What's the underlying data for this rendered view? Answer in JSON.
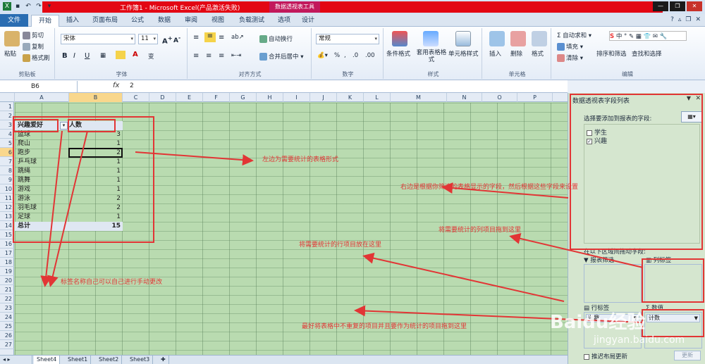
{
  "titlebar": {
    "title": "工作簿1 - Microsoft Excel(产品激活失败)",
    "context_tab": "数据透视表工具"
  },
  "tabs": [
    "文件",
    "开始",
    "插入",
    "页面布局",
    "公式",
    "数据",
    "审阅",
    "视图",
    "负载测试",
    "选项",
    "设计"
  ],
  "ribbon": {
    "clipboard": {
      "paste": "粘贴",
      "cut": "剪切",
      "copy": "复制",
      "format_painter": "格式刷",
      "label": "剪贴板"
    },
    "font": {
      "name": "宋体",
      "size": "11",
      "label": "字体"
    },
    "alignment": {
      "wrap": "自动换行",
      "merge": "合并后居中",
      "label": "对齐方式"
    },
    "number": {
      "format": "常规",
      "label": "数字"
    },
    "styles": {
      "conditional": "条件格式",
      "table": "套用表格格式",
      "cell": "单元格样式",
      "label": "样式"
    },
    "cells": {
      "insert": "插入",
      "delete": "删除",
      "format": "格式",
      "label": "单元格"
    },
    "editing": {
      "autosum": "自动求和",
      "fill": "填充",
      "clear": "清除",
      "sort": "排序和筛选",
      "find": "查找和选择",
      "label": "编辑"
    }
  },
  "formula_bar": {
    "name_box": "B6",
    "fx": "fx",
    "value": "2"
  },
  "columns": [
    "A",
    "B",
    "C",
    "D",
    "E",
    "F",
    "G",
    "H",
    "I",
    "J",
    "K",
    "L",
    "M",
    "N",
    "O",
    "P",
    "Q"
  ],
  "rows": [
    "1",
    "2",
    "3",
    "4",
    "5",
    "6",
    "7",
    "8",
    "9",
    "10",
    "11",
    "12",
    "13",
    "14",
    "15",
    "16",
    "17",
    "18",
    "19",
    "20",
    "21",
    "22",
    "23",
    "24",
    "25",
    "26",
    "27"
  ],
  "pivot": {
    "header_a": "兴趣爱好",
    "header_b": "人数",
    "items": [
      {
        "name": "篮球",
        "count": "3"
      },
      {
        "name": "爬山",
        "count": "1"
      },
      {
        "name": "跑步",
        "count": "2"
      },
      {
        "name": "乒乓球",
        "count": "1"
      },
      {
        "name": "跳绳",
        "count": "1"
      },
      {
        "name": "跳舞",
        "count": "1"
      },
      {
        "name": "游戏",
        "count": "1"
      },
      {
        "name": "游泳",
        "count": "2"
      },
      {
        "name": "羽毛球",
        "count": "2"
      },
      {
        "name": "足球",
        "count": "1"
      }
    ],
    "total_label": "总计",
    "total_value": "15"
  },
  "sheets": [
    "Sheet4",
    "Sheet1",
    "Sheet2",
    "Sheet3"
  ],
  "pane": {
    "title": "数据透视表字段列表",
    "choose_label": "选择要添加到报表的字段:",
    "fields": [
      {
        "name": "学生",
        "checked": ""
      },
      {
        "name": "兴趣",
        "checked": "✓"
      }
    ],
    "drag_label": "在以下区域间拖动字段:",
    "zone_filter": "报表筛选",
    "zone_columns": "列标签",
    "zone_rows": "行标签",
    "zone_values": "数值",
    "row_item": "兴趣",
    "value_item": "计数",
    "defer_label": "推迟布局更新",
    "update_label": "更新"
  },
  "annotations": {
    "left_table": "左边为需要统计的表格形式",
    "right_fields": "右边是根据你筛选的表格显示的字段，然后根据这些字段来设置",
    "column_drag": "将需要统计的列项目拖到这里",
    "row_drag": "将需要统计的行项目放在这里",
    "label_rename": "标签名称自己可以自己进行手动更改",
    "best_practice": "最好将表格中不重复的项目并且要作为统计的项目拖到这里"
  },
  "watermark": {
    "logo": "Baidu经验",
    "url": "jingyan.baidu.com"
  },
  "colors": {
    "annotation": "#e23535",
    "sheet_bg": "#b9dbb0",
    "title_band": "#e30613"
  }
}
